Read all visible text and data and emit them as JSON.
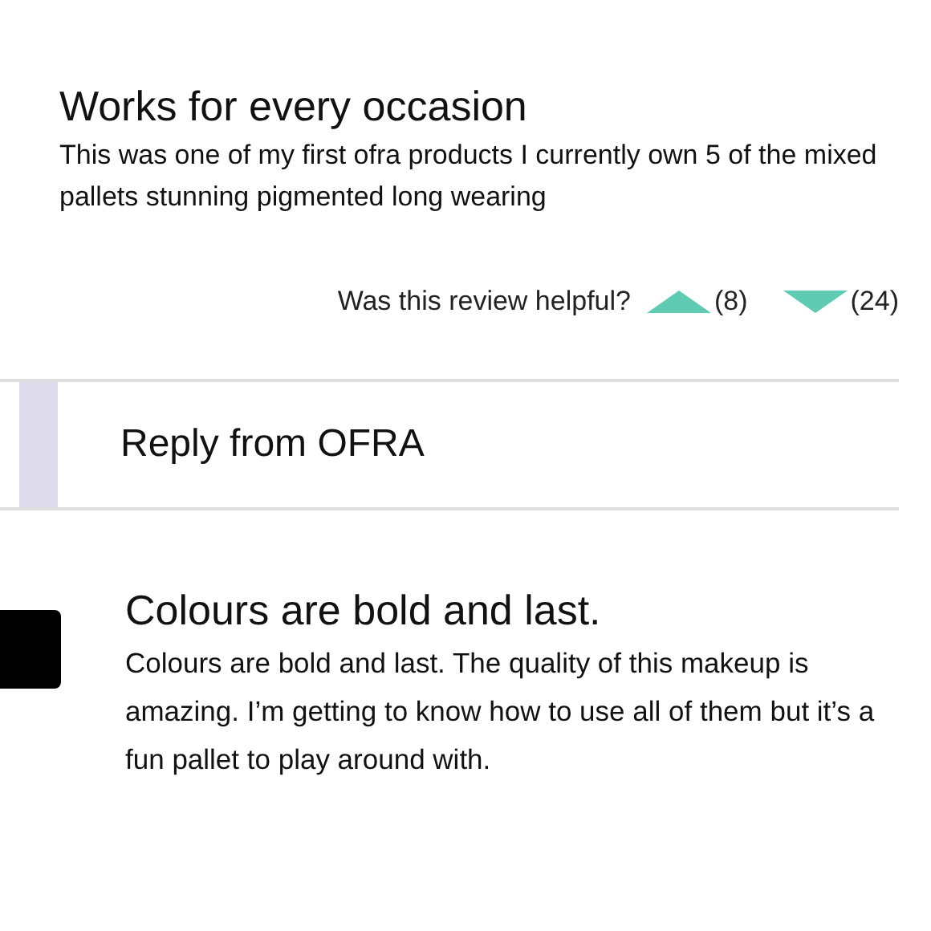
{
  "reviews": [
    {
      "title": "Works for every occasion",
      "body": "This was one of my first ofra products I currently own 5 of the mixed pallets stunning pigmented long wearing",
      "helpful": {
        "question": "Was this review helpful?",
        "up_count": "(8)",
        "down_count": "(24)"
      }
    }
  ],
  "reply": {
    "title": "Reply from OFRA"
  },
  "next_review": {
    "title": "Colours are bold and last.",
    "body": "Colours are bold and last. The quality of this makeup is amazing. I’m getting to know how to use all of them but it’s a fun pallet to play around with."
  }
}
